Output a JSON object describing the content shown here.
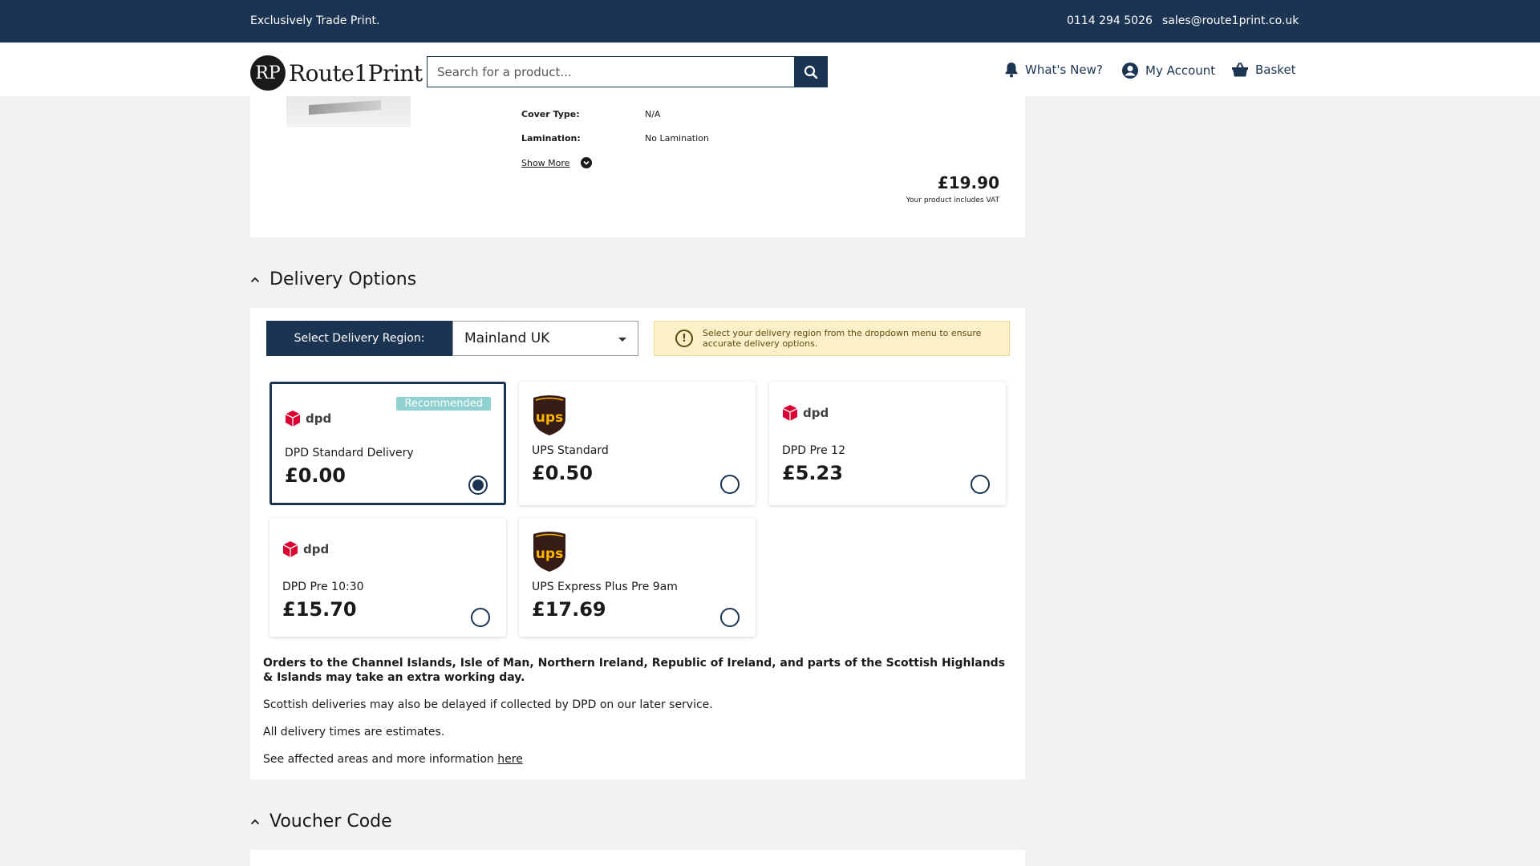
{
  "topbar": {
    "tagline": "Exclusively Trade Print.",
    "phone": "0114 294 5026",
    "email": "sales@route1print.co.uk"
  },
  "header": {
    "logo_mark": "RP",
    "logo_text": "Route1Print",
    "search_placeholder": "Search for a product...",
    "nav": {
      "whats_new": "What's New?",
      "my_account": "My Account",
      "basket": "Basket"
    }
  },
  "product": {
    "specs": [
      {
        "label": "Cover Type:",
        "value": "N/A"
      },
      {
        "label": "Lamination:",
        "value": "No Lamination"
      }
    ],
    "show_more": "Show More",
    "price": "£19.90",
    "vat_note": "Your product includes VAT"
  },
  "delivery": {
    "heading": "Delivery Options",
    "region_label": "Select Delivery Region:",
    "region_value": "Mainland UK",
    "notice": "Select your delivery region from the dropdown menu to ensure accurate delivery options.",
    "recommended_badge": "Recommended",
    "options": [
      {
        "carrier": "dpd",
        "carrier_label": "dpd",
        "name": "DPD Standard Delivery",
        "price": "£0.00",
        "selected": true
      },
      {
        "carrier": "ups",
        "carrier_label": "ups",
        "name": "UPS Standard",
        "price": "£0.50",
        "selected": false
      },
      {
        "carrier": "dpd",
        "carrier_label": "dpd",
        "name": "DPD Pre 12",
        "price": "£5.23",
        "selected": false
      },
      {
        "carrier": "dpd",
        "carrier_label": "dpd",
        "name": "DPD Pre 10:30",
        "price": "£15.70",
        "selected": false
      },
      {
        "carrier": "ups",
        "carrier_label": "ups",
        "name": "UPS Express Plus Pre 9am",
        "price": "£17.69",
        "selected": false
      }
    ],
    "notes": {
      "extra_day": "Orders to the Channel Islands, Isle of Man, Northern Ireland, Republic of Ireland, and parts of the Scottish Highlands & Islands may take an extra working day.",
      "scottish": "Scottish deliveries may also be delayed if collected by DPD on our later service.",
      "estimates": "All delivery times are estimates.",
      "affected_prefix": "See affected areas and more information ",
      "affected_link": "here"
    }
  },
  "voucher": {
    "heading": "Voucher Code"
  },
  "colors": {
    "navy": "#1b3452",
    "dpd_red": "#dc0032",
    "ups_brown": "#351c15",
    "ups_gold": "#ffb500",
    "badge_teal": "#8fd0d1",
    "notice_bg": "#fdf0c8"
  }
}
